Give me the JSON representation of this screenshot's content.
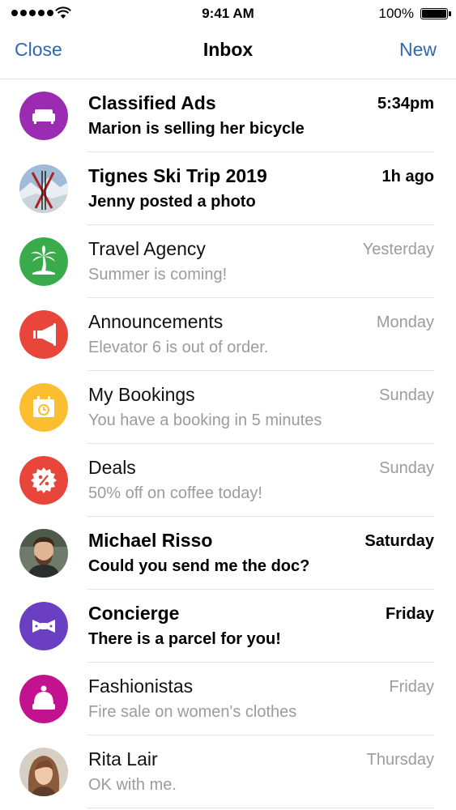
{
  "status_bar": {
    "time": "9:41 AM",
    "battery": "100%"
  },
  "nav": {
    "close_label": "Close",
    "title": "Inbox",
    "new_label": "New"
  },
  "messages": [
    {
      "title": "Classified Ads",
      "subtitle": "Marion is selling her bicycle",
      "time": "5:34pm",
      "unread": true,
      "icon": "sofa-icon",
      "color": "#9b2bb0"
    },
    {
      "title": "Tignes Ski Trip 2019",
      "subtitle": "Jenny posted a photo",
      "time": "1h ago",
      "unread": true,
      "icon": "ski-photo",
      "color": "#8aa6c8"
    },
    {
      "title": "Travel Agency",
      "subtitle": "Summer is coming!",
      "time": "Yesterday",
      "unread": false,
      "icon": "palm-tree-icon",
      "color": "#3aab4b"
    },
    {
      "title": "Announcements",
      "subtitle": "Elevator 6 is out of order.",
      "time": "Monday",
      "unread": false,
      "icon": "megaphone-icon",
      "color": "#e8463a"
    },
    {
      "title": "My Bookings",
      "subtitle": "You have a booking in 5 minutes",
      "time": "Sunday",
      "unread": false,
      "icon": "calendar-clock-icon",
      "color": "#fbbe2e"
    },
    {
      "title": "Deals",
      "subtitle": "50% off on coffee today!",
      "time": "Sunday",
      "unread": false,
      "icon": "percent-badge-icon",
      "color": "#e8463a"
    },
    {
      "title": "Michael Risso",
      "subtitle": "Could you send me the doc?",
      "time": "Saturday",
      "unread": true,
      "icon": "person-photo",
      "color": "#3b3f3a"
    },
    {
      "title": "Concierge",
      "subtitle": "There is a parcel for you!",
      "time": "Friday",
      "unread": true,
      "icon": "bow-tie-icon",
      "color": "#6a3fc1"
    },
    {
      "title": "Fashionistas",
      "subtitle": "Fire sale on women's clothes",
      "time": "Friday",
      "unread": false,
      "icon": "beanie-hat-icon",
      "color": "#c2128f"
    },
    {
      "title": "Rita Lair",
      "subtitle": "OK with me.",
      "time": "Thursday",
      "unread": false,
      "icon": "person-photo",
      "color": "#a06d4f"
    }
  ]
}
